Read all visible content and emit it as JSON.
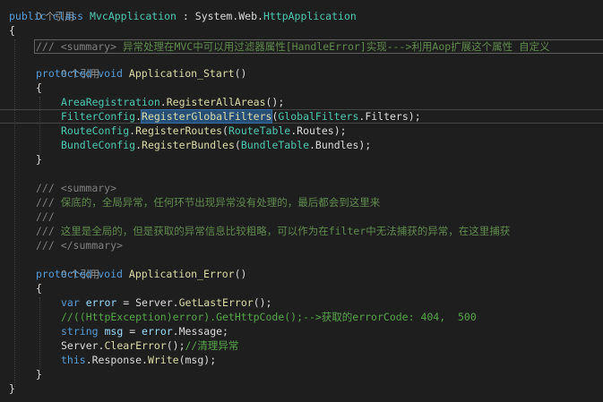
{
  "editor": {
    "l01_ref": "0 个引用",
    "l02_kw_public": "public",
    "l02_kw_class": "class",
    "l02_class_name": "MvcApplication",
    "l02_colon": " : ",
    "l02_ns": "System.Web.",
    "l02_base": "HttpApplication",
    "l03_brace": "{",
    "l04_doc_slash": "/// ",
    "l04_doc_tag": "<summary>",
    "l04_doc_text": " 异常处理在MVC中可以用过滤器属性[HandleError]实现--->利用Aop扩展这个属性 自定义",
    "l05_ref": "0 个引用",
    "l06_kw_protected": "protected",
    "l06_kw_void": "void",
    "l06_method": "Application_Start",
    "l06_parens": "()",
    "l07_brace": "{",
    "l08_type": "AreaRegistration",
    "l08_dot": ".",
    "l08_method": "RegisterAllAreas",
    "l08_end": "();",
    "l09_type": "FilterConfig",
    "l09_dot": ".",
    "l09_method": "RegisterGlobalFilters",
    "l09_open": "(",
    "l09_arg_type": "GlobalFilters",
    "l09_arg_rest": ".Filters);",
    "l10_type": "RouteConfig",
    "l10_dot": ".",
    "l10_method": "RegisterRoutes",
    "l10_open": "(",
    "l10_arg_type": "RouteTable",
    "l10_arg_rest": ".Routes);",
    "l11_type": "BundleConfig",
    "l11_dot": ".",
    "l11_method": "RegisterBundles",
    "l11_open": "(",
    "l11_arg_type": "BundleTable",
    "l11_arg_rest": ".Bundles);",
    "l12_brace": "}",
    "l14_slash": "/// ",
    "l14_tag": "<summary>",
    "l15_slash": "/// ",
    "l15_text": "保底的，全局异常，任何环节出现异常没有处理的，最后都会到这里来",
    "l16_slash": "///",
    "l17_slash": "/// ",
    "l17_text": "这里是全局的，但是获取的异常信息比较粗略，可以作为在filter中无法捕获的异常，在这里捕获",
    "l18_slash": "/// ",
    "l18_tag": "</summary>",
    "l19_ref": "0 个引用",
    "l20_kw_protected": "protected",
    "l20_kw_void": "void",
    "l20_method": "Application_Error",
    "l20_parens": "()",
    "l21_brace": "{",
    "l22_kw_var": "var",
    "l22_var": "error",
    "l22_eq": " = Server.",
    "l22_method": "GetLastError",
    "l22_end": "();",
    "l23_comment": "//((HttpException)error).GetHttpCode();-->获取的errorCode: 404,  500",
    "l24_kw_string": "string",
    "l24_var": "msg",
    "l24_eq": " = ",
    "l24_obj": "error",
    "l24_rest": ".Message;",
    "l25_obj": "Server.",
    "l25_method": "ClearError",
    "l25_end": "();",
    "l25_comment": "//清理异常",
    "l26_kw_this": "this",
    "l26_mid": ".Response.",
    "l26_method": "Write",
    "l26_end": "(msg);",
    "l27_brace": "}",
    "l28_brace": "}"
  },
  "colors": {
    "background": "#1e1e1e",
    "keyword": "#569cd6",
    "type": "#4ec9b0",
    "method": "#dcdcaa",
    "comment": "#57a64a",
    "doc_comment_text": "#608b4e",
    "doc_comment_tag": "#808080",
    "selection": "#264f78"
  }
}
